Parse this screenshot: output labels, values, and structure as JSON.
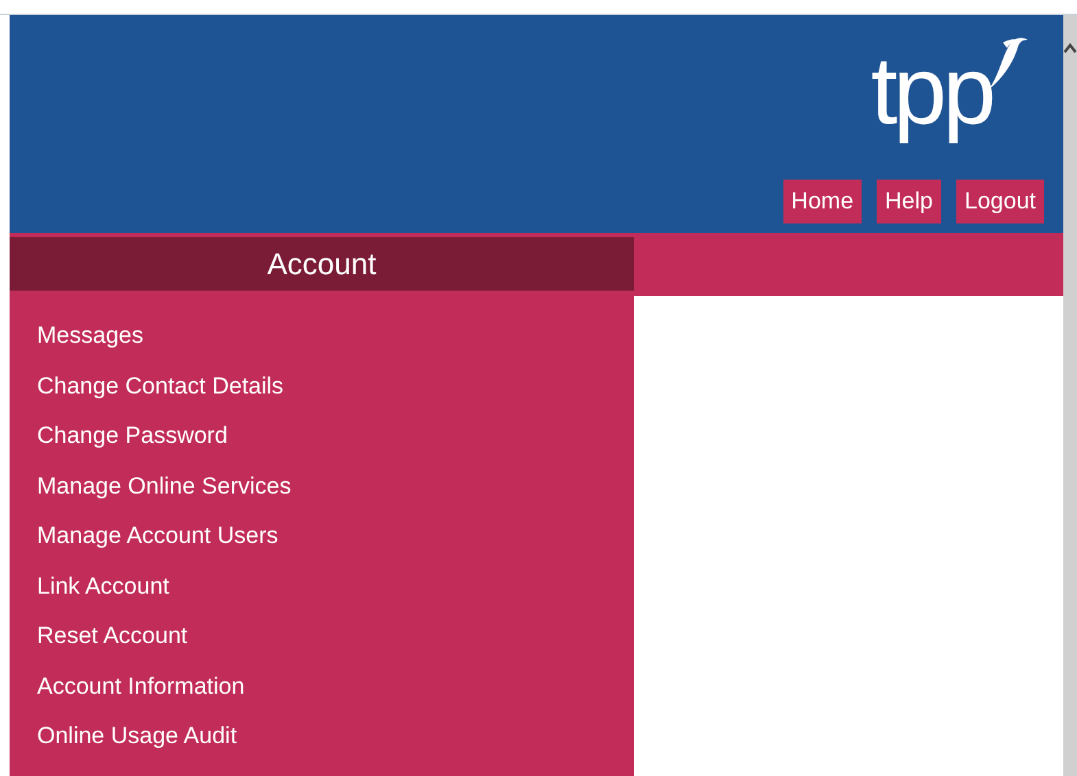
{
  "header": {
    "logo": "tpp",
    "nav": [
      {
        "label": "Home"
      },
      {
        "label": "Help"
      },
      {
        "label": "Logout"
      }
    ]
  },
  "sidebar": {
    "title": "Account",
    "items": [
      {
        "label": "Messages"
      },
      {
        "label": "Change Contact Details"
      },
      {
        "label": "Change Password"
      },
      {
        "label": "Manage Online Services"
      },
      {
        "label": "Manage Account Users"
      },
      {
        "label": "Link Account"
      },
      {
        "label": "Reset Account"
      },
      {
        "label": "Account Information"
      },
      {
        "label": "Online Usage Audit"
      }
    ]
  }
}
